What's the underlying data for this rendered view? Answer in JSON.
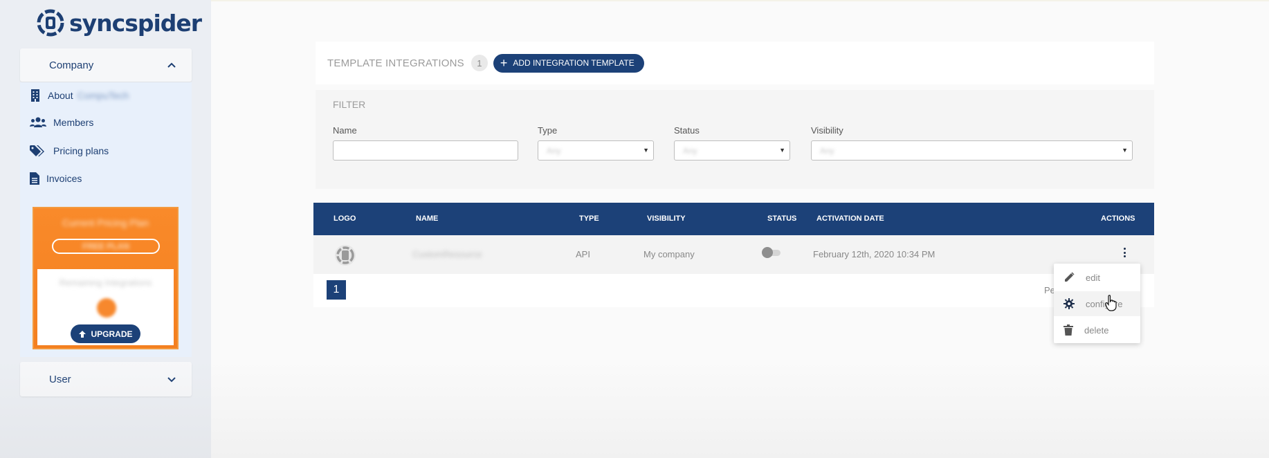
{
  "brand": {
    "logo_text": "syncspider"
  },
  "sidebar": {
    "company_header": "Company",
    "menu": [
      {
        "label": "About",
        "suffix_blurred": "CompuTech",
        "icon": "building-icon"
      },
      {
        "label": "Members",
        "icon": "users-icon"
      },
      {
        "label": "Pricing plans",
        "icon": "tags-icon"
      },
      {
        "label": "Invoices",
        "icon": "file-icon"
      }
    ],
    "plan_card": {
      "title_blurred": "Current Pricing Plan",
      "plan_name_blurred": "FREE PLAN",
      "remaining_blurred": "Remaining Integrations",
      "upgrade_label": "UPGRADE"
    },
    "user_header": "User"
  },
  "main": {
    "template_integrations": {
      "title": "TEMPLATE INTEGRATIONS",
      "count": "1",
      "add_button": "ADD INTEGRATION TEMPLATE"
    },
    "filter": {
      "title": "FILTER",
      "name_label": "Name",
      "name_value": "",
      "type_label": "Type",
      "type_value": "Any",
      "status_label": "Status",
      "status_value": "Any",
      "visibility_label": "Visibility",
      "visibility_value": "Any"
    },
    "table": {
      "headers": [
        "LOGO",
        "NAME",
        "TYPE",
        "VISIBILITY",
        "STATUS",
        "ACTIVATION DATE",
        "ACTIONS"
      ],
      "rows": [
        {
          "name_blurred": "CustomResource",
          "type": "API",
          "visibility": "My company",
          "status_on": false,
          "activation_date": "February 12th, 2020 10:34 PM"
        }
      ],
      "current_page": "1",
      "per_page_label_partial": "Pe"
    },
    "row_actions_menu": {
      "items": [
        {
          "label": "edit",
          "icon": "pencil-icon"
        },
        {
          "label": "configure",
          "icon": "gear-icon"
        },
        {
          "label": "delete",
          "icon": "trash-icon"
        }
      ]
    }
  },
  "colors": {
    "primary": "#1c4178",
    "accent_orange": "#f47f1f",
    "sidebar_bg": "#ebeef3"
  }
}
